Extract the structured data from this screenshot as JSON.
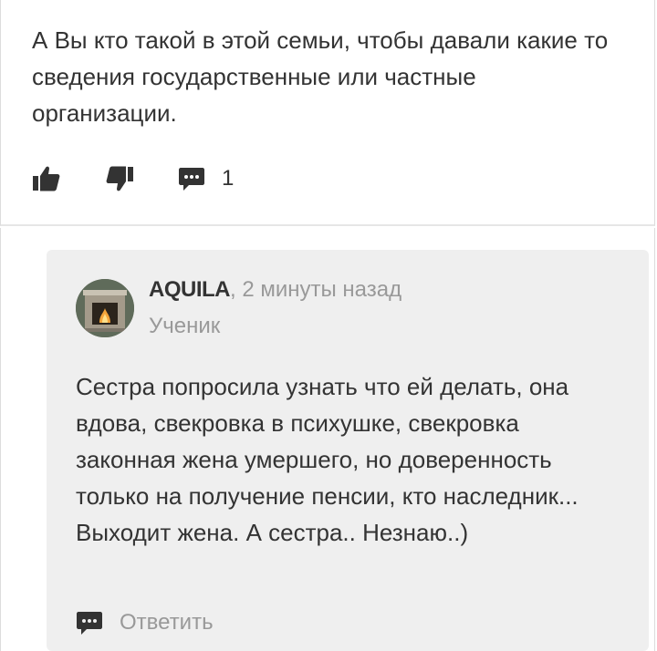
{
  "answer": {
    "text": "А Вы кто такой в этой семьи, чтобы давали какие то сведения государственные или частные организации.",
    "comment_count": "1"
  },
  "reply": {
    "author": "AQUILA",
    "time": ", 2 минуты назад",
    "rank": "Ученик",
    "text": "Сестра попросила узнать что ей делать, она вдова, свекровка в психушке, свекровка законная жена умершего, но доверенность только на получение пенсии, кто наследник... Выходит жена. А сестра.. Незнаю..)",
    "reply_label": "Ответить"
  },
  "icons": {
    "like": "thumbs-up-icon",
    "dislike": "thumbs-down-icon",
    "comments": "comment-bubble-icon",
    "reply": "comment-bubble-icon"
  },
  "colors": {
    "text": "#333333",
    "muted": "#999999",
    "reply_background": "#efefef"
  }
}
